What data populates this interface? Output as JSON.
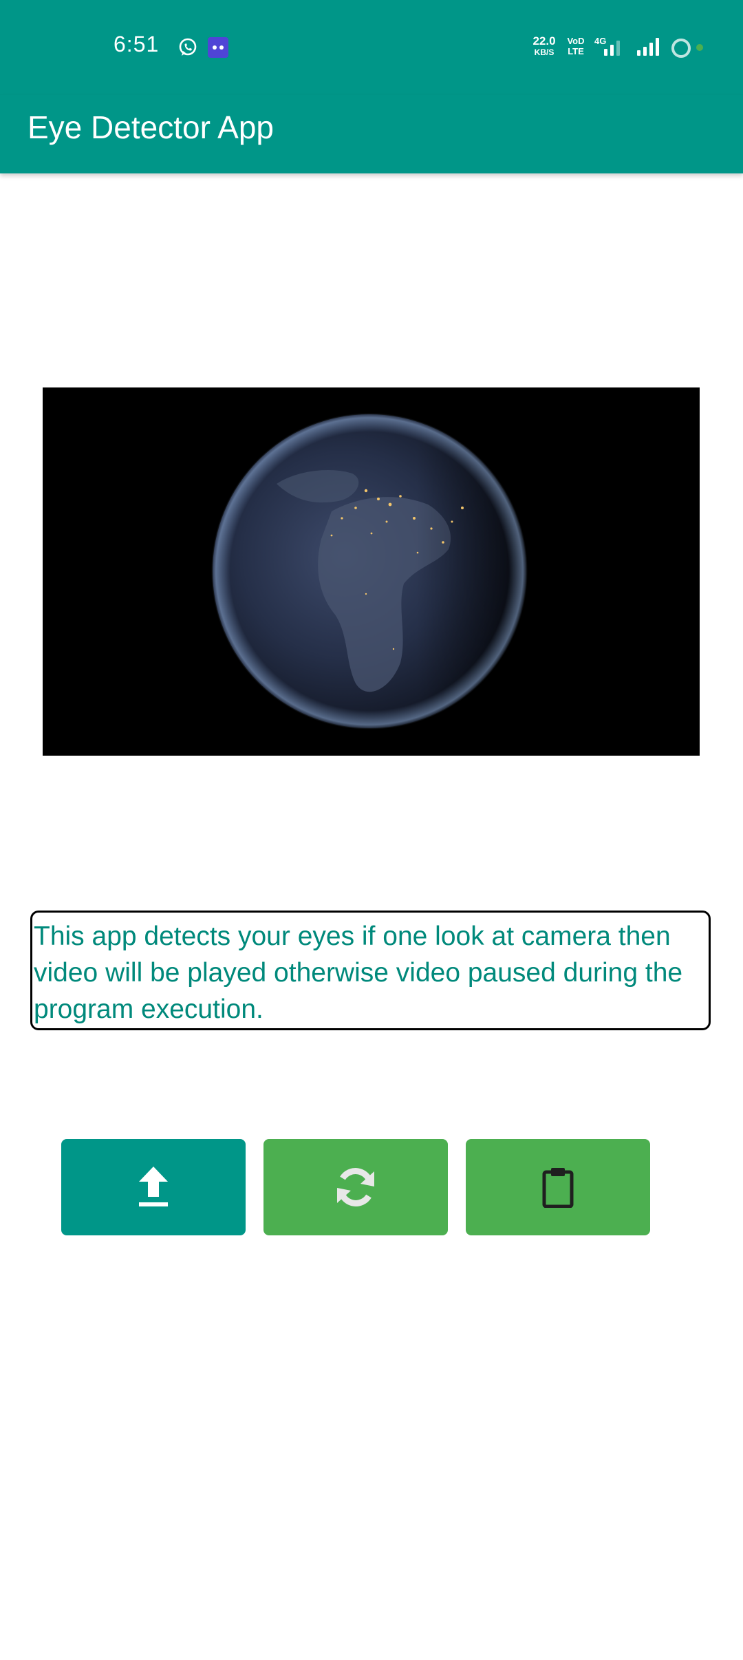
{
  "status_bar": {
    "time": "6:51",
    "net_speed_value": "22.0",
    "net_speed_unit": "KB/S",
    "volte_top": "VoD",
    "volte_bottom": "LTE",
    "lte_tag": "4G",
    "icons": [
      "whatsapp-icon",
      "bot-notification-icon",
      "signal-icon",
      "ring-icon",
      "dot-icon"
    ],
    "accent": "#009688"
  },
  "app_bar": {
    "title": "Eye Detector App"
  },
  "video": {
    "subject": "earth-at-night"
  },
  "description": {
    "text": "This app detects your eyes if one look at camera then video will be played otherwise video paused during the program execution."
  },
  "buttons": [
    {
      "icon": "upload-icon",
      "color": "#009688"
    },
    {
      "icon": "refresh-icon",
      "color": "#4caf50"
    },
    {
      "icon": "clipboard-icon",
      "color": "#4caf50"
    }
  ]
}
